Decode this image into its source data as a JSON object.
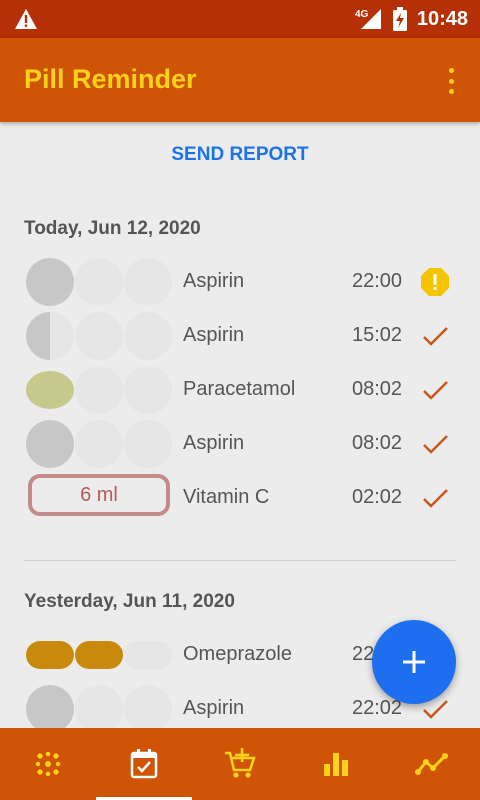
{
  "status_bar": {
    "network": "4G",
    "time": "10:48"
  },
  "app": {
    "title": "Pill Reminder"
  },
  "actions": {
    "send_report": "SEND REPORT"
  },
  "days": [
    {
      "header": "Today, Jun 12, 2020",
      "entries": [
        {
          "name": "Aspirin",
          "time": "22:00",
          "status": "warning-icon",
          "dose": "1 tablet"
        },
        {
          "name": "Aspirin",
          "time": "15:02",
          "status": "check-icon",
          "dose": "1/2 tablet"
        },
        {
          "name": "Paracetamol",
          "time": "08:02",
          "status": "check-icon",
          "dose": "1 tablet"
        },
        {
          "name": "Aspirin",
          "time": "08:02",
          "status": "check-icon",
          "dose": "1 tablet"
        },
        {
          "name": "Vitamin C",
          "time": "02:02",
          "status": "check-icon",
          "dose": "6 ml"
        }
      ]
    },
    {
      "header": "Yesterday, Jun 11, 2020",
      "entries": [
        {
          "name": "Omeprazole",
          "time": "22:02",
          "status": "check-icon",
          "dose": "2 capsules"
        },
        {
          "name": "Aspirin",
          "time": "22:02",
          "status": "check-icon",
          "dose": "1 tablet"
        }
      ]
    }
  ],
  "fab_icon": "plus-icon",
  "bottom_nav": [
    {
      "icon": "pills-icon",
      "active": false
    },
    {
      "icon": "calendar-check-icon",
      "active": true
    },
    {
      "icon": "cart-add-icon",
      "active": false
    },
    {
      "icon": "bar-chart-icon",
      "active": false
    },
    {
      "icon": "trend-line-icon",
      "active": false
    }
  ],
  "colors": {
    "status_bar": "#b52f07",
    "app_bar": "#cf5406",
    "title": "#ffd21a",
    "accent_blue": "#1e6ff0",
    "check": "#c9561a",
    "warning": "#f5c400"
  }
}
